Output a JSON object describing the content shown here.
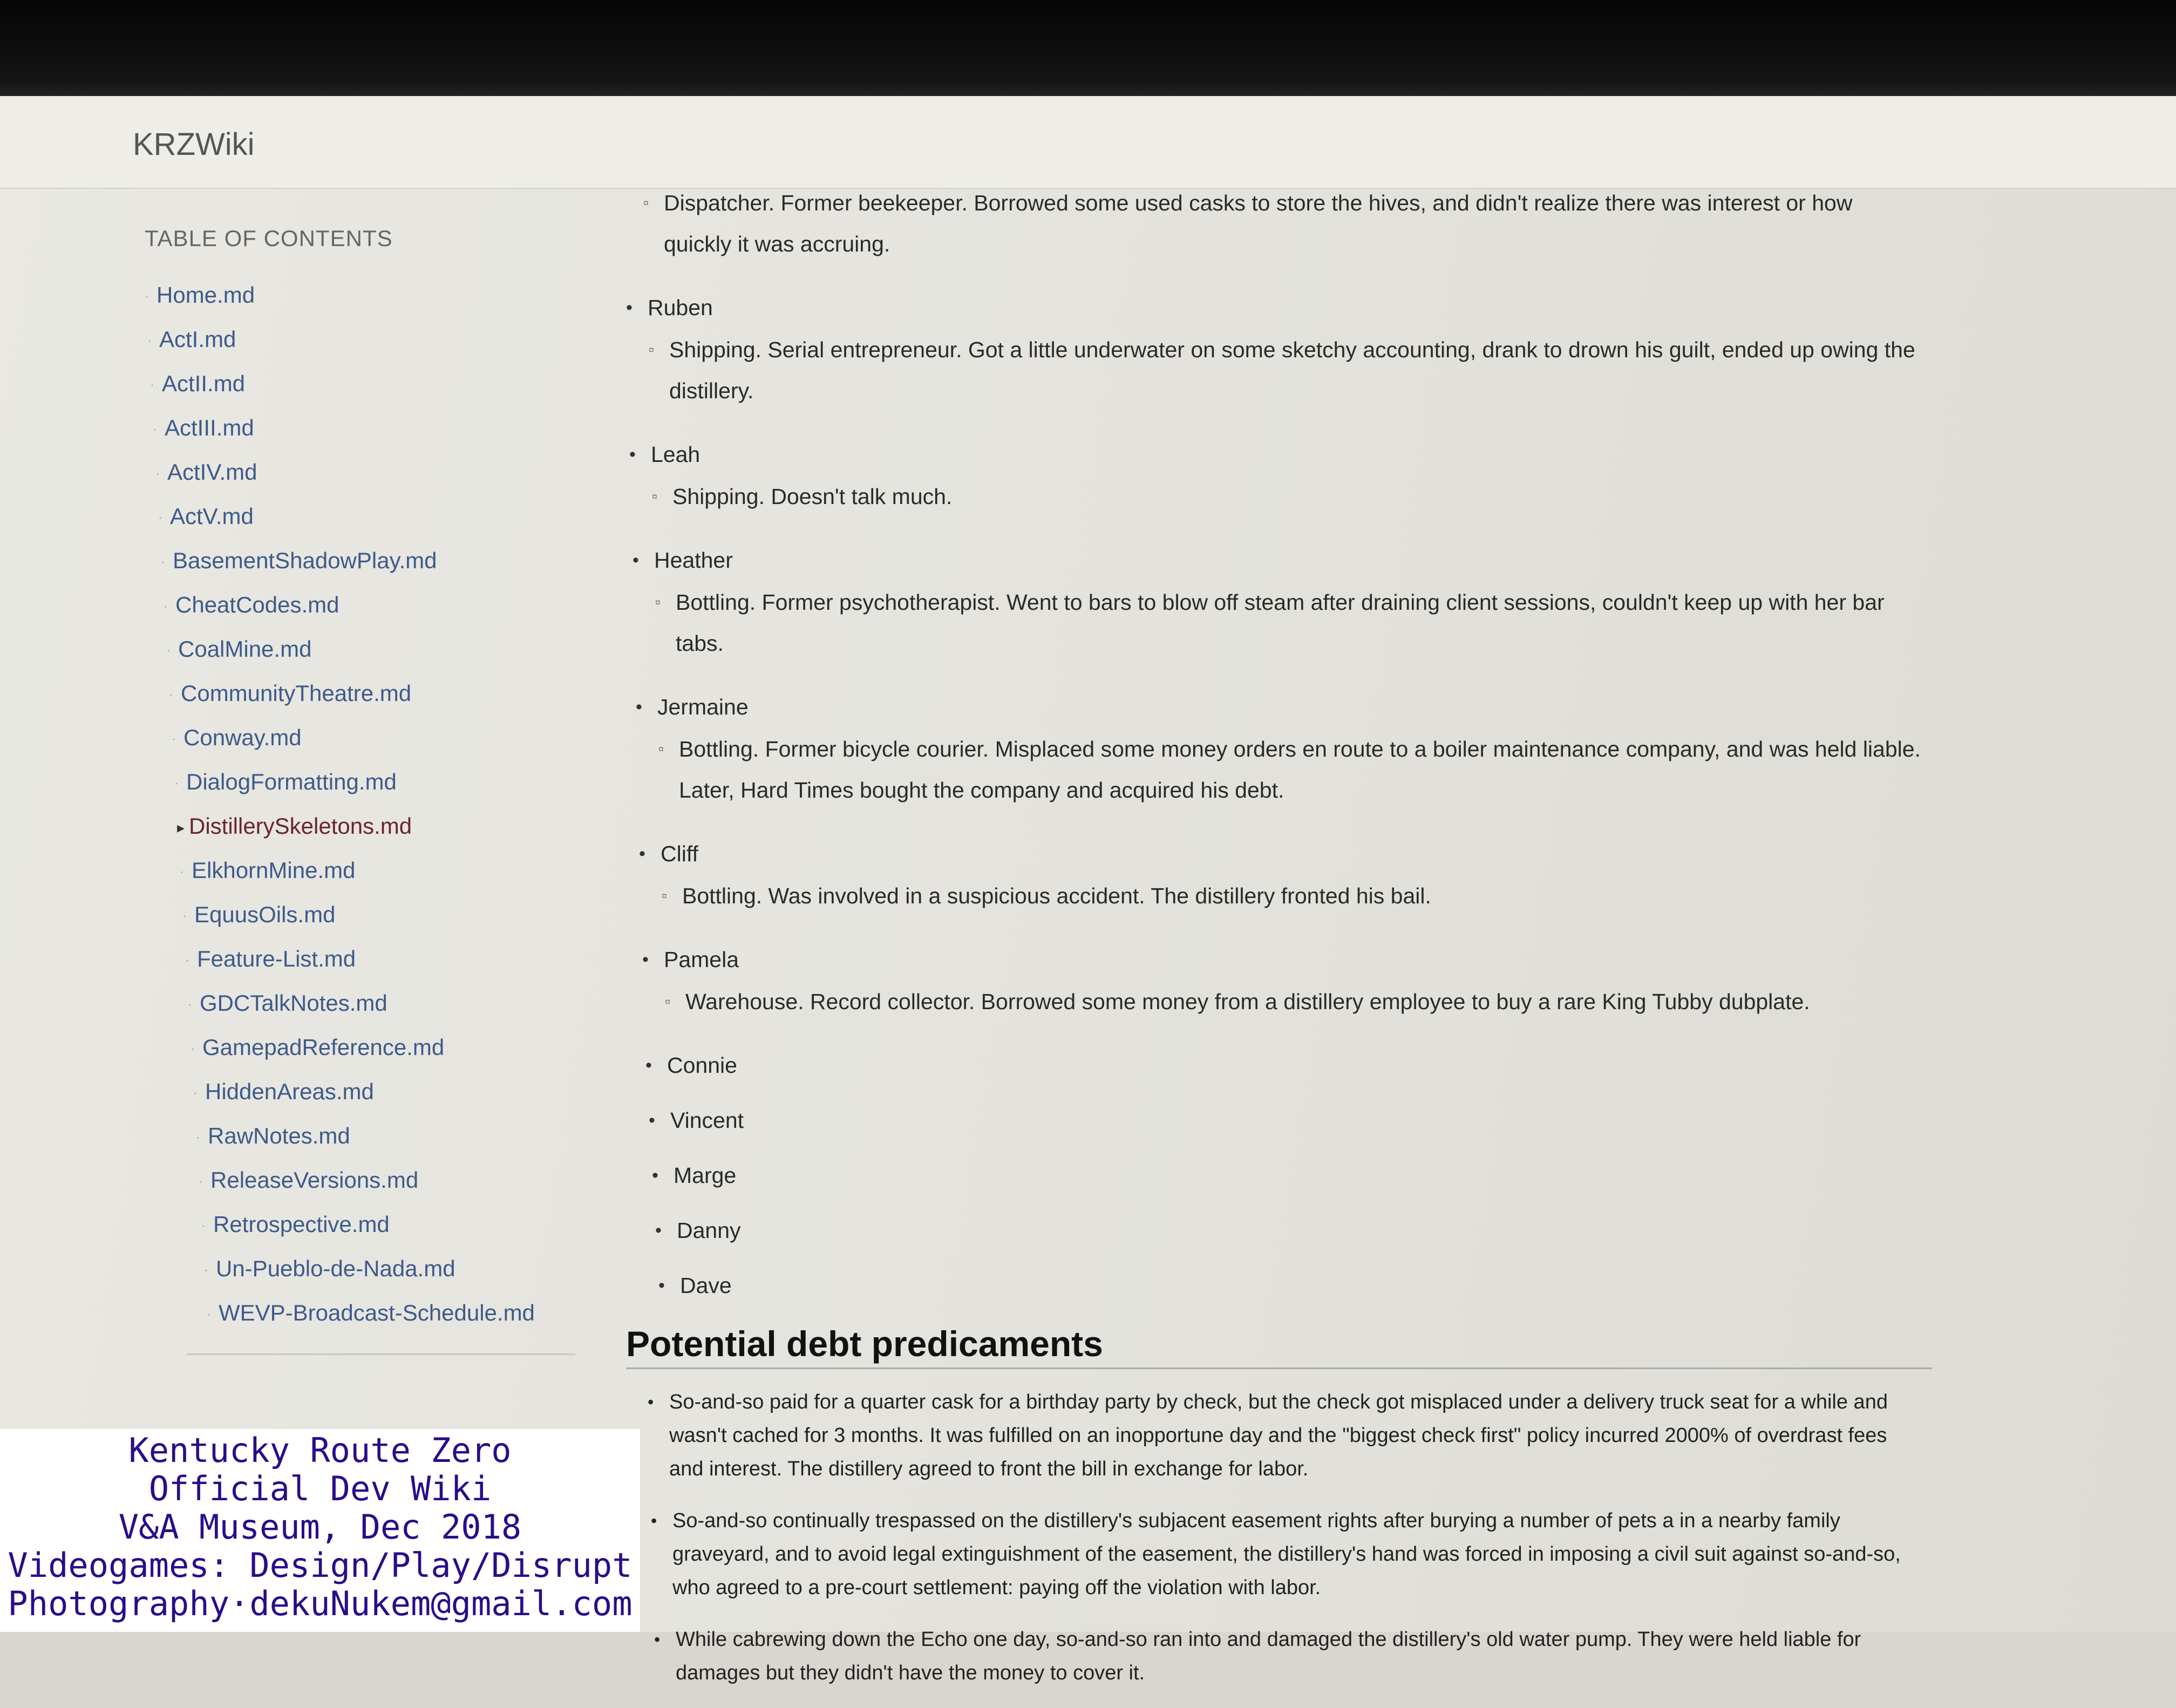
{
  "app": {
    "title": "KRZWiki"
  },
  "sidebar": {
    "heading": "TABLE OF CONTENTS",
    "items": [
      {
        "label": "Home.md"
      },
      {
        "label": "ActI.md"
      },
      {
        "label": "ActII.md"
      },
      {
        "label": "ActIII.md"
      },
      {
        "label": "ActIV.md"
      },
      {
        "label": "ActV.md"
      },
      {
        "label": "BasementShadowPlay.md"
      },
      {
        "label": "CheatCodes.md"
      },
      {
        "label": "CoalMine.md"
      },
      {
        "label": "CommunityTheatre.md"
      },
      {
        "label": "Conway.md"
      },
      {
        "label": "DialogFormatting.md"
      },
      {
        "label": "DistillerySkeletons.md",
        "active": true
      },
      {
        "label": "ElkhornMine.md"
      },
      {
        "label": "EquusOils.md"
      },
      {
        "label": "Feature-List.md"
      },
      {
        "label": "GDCTalkNotes.md"
      },
      {
        "label": "GamepadReference.md"
      },
      {
        "label": "HiddenAreas.md"
      },
      {
        "label": "RawNotes.md"
      },
      {
        "label": "ReleaseVersions.md"
      },
      {
        "label": "Retrospective.md"
      },
      {
        "label": "Un-Pueblo-de-Nada.md"
      },
      {
        "label": "WEVP-Broadcast-Schedule.md"
      }
    ]
  },
  "content": {
    "first_detail": "Dispatcher. Former beekeeper. Borrowed some used casks to store the hives, and didn't realize there was interest or how quickly it was accruing.",
    "people": [
      {
        "name": "Ruben",
        "detail": "Shipping. Serial entrepreneur. Got a little underwater on some sketchy accounting, drank to drown his guilt, ended up owing the distillery."
      },
      {
        "name": "Leah",
        "detail": "Shipping. Doesn't talk much."
      },
      {
        "name": "Heather",
        "detail": "Bottling. Former psychotherapist. Went to bars to blow off steam after draining client sessions, couldn't keep up with her bar tabs."
      },
      {
        "name": "Jermaine",
        "detail": "Bottling. Former bicycle courier. Misplaced some money orders en route to a boiler maintenance company, and was held liable. Later, Hard Times bought the company and acquired his debt."
      },
      {
        "name": "Cliff",
        "detail": "Bottling. Was involved in a suspicious accident. The distillery fronted his bail."
      },
      {
        "name": "Pamela",
        "detail": "Warehouse. Record collector. Borrowed some money from a distillery employee to buy a rare King Tubby dubplate."
      },
      {
        "name": "Connie"
      },
      {
        "name": "Vincent"
      },
      {
        "name": "Marge"
      },
      {
        "name": "Danny"
      },
      {
        "name": "Dave"
      }
    ],
    "section_heading": "Potential debt predicaments",
    "debts": [
      "So-and-so paid for a quarter cask for a birthday party by check, but the check got misplaced under a delivery truck seat for a while and wasn't cached for 3 months. It was fulfilled on an inopportune day and the \"biggest check first\" policy incurred 2000% of overdrast fees and interest. The distillery agreed to front the bill in exchange for labor.",
      "So-and-so continually trespassed on the distillery's subjacent easement rights after burying a number of pets a in a nearby family graveyard, and to avoid legal extinguishment of the easement, the distillery's hand was forced in imposing a civil suit against so-and-so, who agreed to a pre-court settlement: paying off the violation with labor.",
      "While cabrewing down the Echo one day, so-and-so ran into and damaged the distillery's old water pump. They were held liable for damages but they didn't have the money to cover it."
    ]
  },
  "caption": {
    "lines": [
      "Kentucky Route Zero",
      "Official Dev Wiki",
      "V&A Museum, Dec 2018",
      "Videogames: Design/Play/Disrupt",
      "Photography·dekuNukem@gmail.com"
    ]
  }
}
